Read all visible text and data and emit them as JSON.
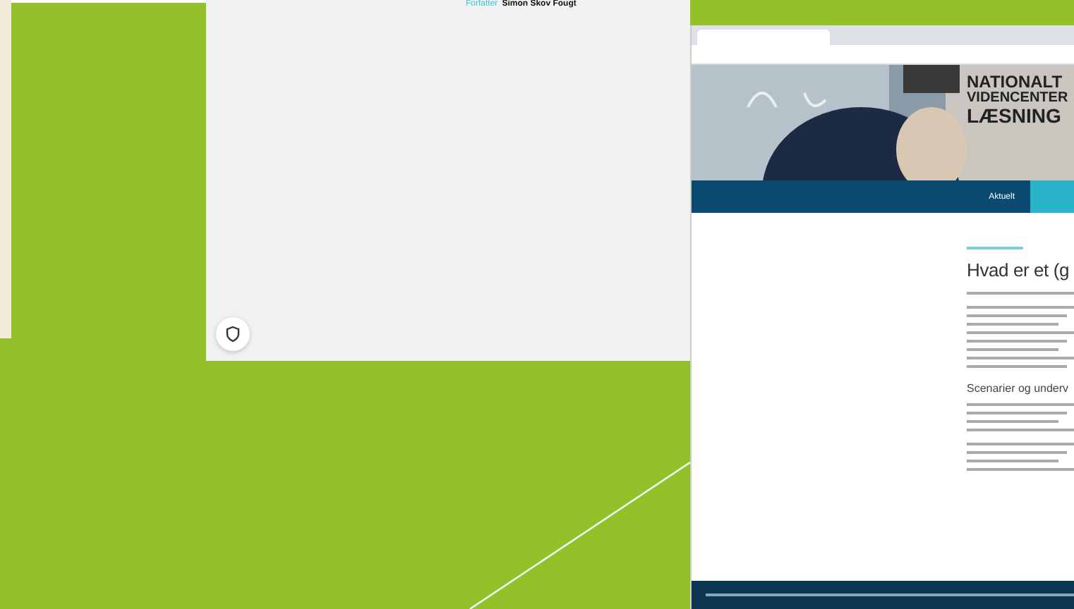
{
  "author": {
    "label": "Forfatter",
    "name": "Simon Skov Fougt"
  },
  "screenshot": {
    "logo_lines": [
      "NATIONALT",
      "VIDENCENTER",
      "LÆSNING"
    ],
    "nav_items": [
      {
        "label": "Aktuelt",
        "selected": false
      }
    ],
    "article": {
      "heading": "Hvad er et (g",
      "subheading": "Scenarier og underv"
    }
  }
}
